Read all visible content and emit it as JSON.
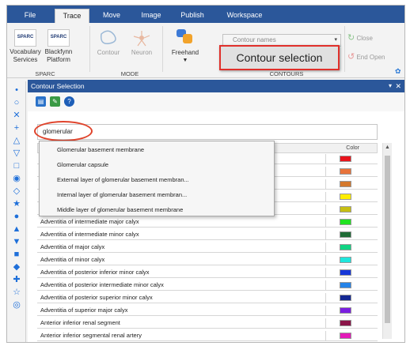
{
  "tabs": [
    "File",
    "Trace",
    "Move",
    "Image",
    "Publish",
    "Workspace"
  ],
  "ribbon": {
    "sparc1_logo": "SPARC",
    "sparc2_logo": "SPARC",
    "vocab": "Vocabulary Services",
    "blackfynn": "Blackfynn Platform",
    "contour": "Contour",
    "neuron": "Neuron",
    "freehand": "Freehand",
    "contour_names": "Contour names",
    "close": "Close",
    "end_open": "End Open",
    "group_sparc": "SPARC",
    "group_mode": "MODE",
    "group_contours": "CONTOURS"
  },
  "callout": "Contour selection",
  "panel": {
    "title": "Contour Selection",
    "search_value": "glomerular",
    "color_header": "Color"
  },
  "suggestions": [
    "Glomerular basement membrane",
    "Glomerular capsule",
    "External layer of glomerular basement membran...",
    "Internal layer of glomerular basement membran...",
    "Middle layer of glomerular basement membrane"
  ],
  "rows": [
    {
      "name": "",
      "color": "#e8141c"
    },
    {
      "name": "",
      "color": "#e8733a"
    },
    {
      "name": "",
      "color": "#d4782c"
    },
    {
      "name": "",
      "color": "#ffee00"
    },
    {
      "name": "",
      "color": "#c6be12"
    },
    {
      "name": "Adventitia of intermediate major calyx",
      "color": "#21e321"
    },
    {
      "name": "Adventitia of intermediate minor calyx",
      "color": "#1f6b36"
    },
    {
      "name": "Adventitia of major calyx",
      "color": "#11d483"
    },
    {
      "name": "Adventitia of minor calyx",
      "color": "#1ee6dc"
    },
    {
      "name": "Adventitia of posterior inferior minor calyx",
      "color": "#1637d8"
    },
    {
      "name": "Adventitia of posterior intermediate minor calyx",
      "color": "#2583e8"
    },
    {
      "name": "Adventitia of posterior superior minor calyx",
      "color": "#142893"
    },
    {
      "name": "Adventitia of superior major calyx",
      "color": "#7a1fe0"
    },
    {
      "name": "Anterior inferior renal segment",
      "color": "#8a1448"
    },
    {
      "name": "Anterior inferior segmental renal artery",
      "color": "#e31ab8"
    }
  ]
}
